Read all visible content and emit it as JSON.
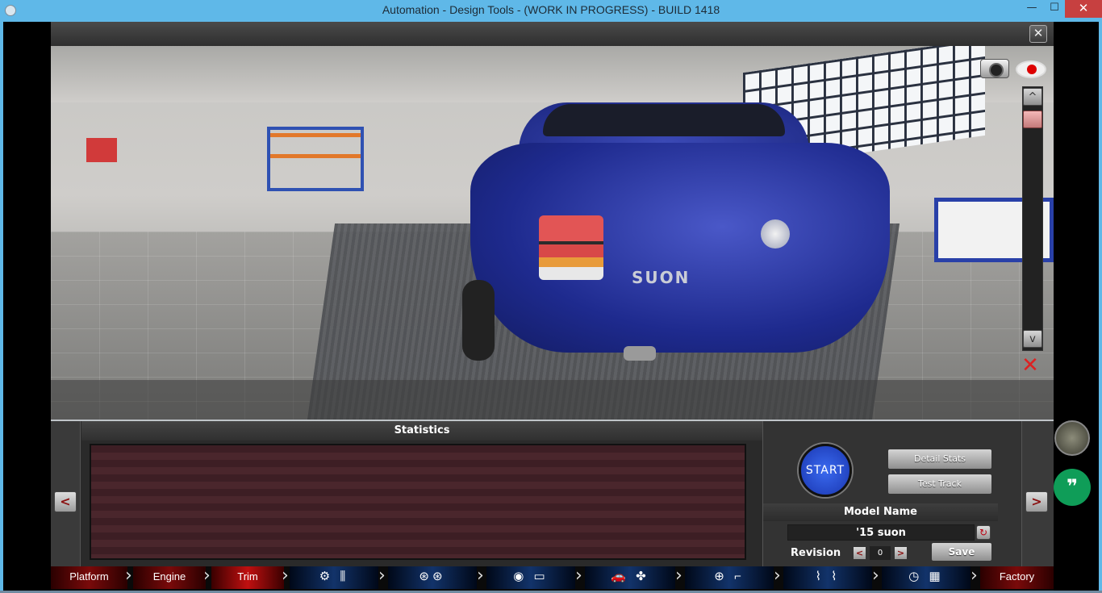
{
  "window": {
    "title": "Automation - Design Tools - (WORK IN PROGRESS) - BUILD 1418",
    "min_glyph": "—",
    "max_glyph": "☐",
    "close_glyph": "✕"
  },
  "viewport": {
    "close_glyph": "✕",
    "zoom_up_glyph": "^",
    "zoom_down_glyph": "v",
    "car_badge_text": "SUON",
    "hide_ui_glyph": "✕"
  },
  "statistics": {
    "header": "Statistics"
  },
  "controls": {
    "prev_glyph": "<",
    "next_glyph": ">",
    "start_label": "START",
    "detail_stats_label": "Detail Stats",
    "test_track_label": "Test Track",
    "model_name_label": "Model Name",
    "model_name_value": "'15 suon",
    "refresh_glyph": "↻",
    "revision_label": "Revision",
    "revision_value": "0",
    "rev_prev_glyph": "<",
    "rev_next_glyph": ">",
    "save_label": "Save"
  },
  "nav": {
    "platform": "Platform",
    "engine": "Engine",
    "trim": "Trim",
    "engine_parts_glyphs": "⚙ ⫼",
    "wheels_glyphs": "⊛⊛",
    "brakes_glyphs": "◉ ▭",
    "body_glyphs": "🚗 ✤",
    "interior_glyphs": "⊕ ⌐",
    "suspension_glyphs": "⌇ ⌇",
    "testing_glyphs": "◷ ▦",
    "factory": "Factory",
    "sep_glyph": "›"
  },
  "side": {
    "chat_glyph": "❞"
  }
}
